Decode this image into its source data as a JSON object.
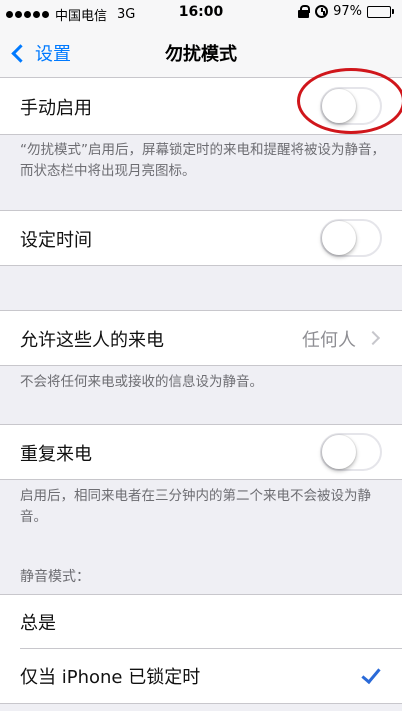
{
  "status_bar": {
    "carrier": "中国电信",
    "network": "3G",
    "time": "16:00",
    "battery": "97%",
    "battery_level": 0.97
  },
  "nav": {
    "back_label": "设置",
    "title": "勿扰模式"
  },
  "manual": {
    "label": "手动启用",
    "switch_on": false,
    "footer": "“勿扰模式”启用后，屏幕锁定时的来电和提醒将被设为静音，而状态栏中将出现月亮图标。"
  },
  "scheduled": {
    "label": "设定时间",
    "switch_on": false
  },
  "allow_calls": {
    "label": "允许这些人的来电",
    "value": "任何人",
    "footer": "不会将任何来电或接收的信息设为静音。"
  },
  "repeated": {
    "label": "重复来电",
    "switch_on": false,
    "footer": "启用后，相同来电者在三分钟内的第二个来电不会被设为静音。"
  },
  "silence": {
    "header": "静音模式：",
    "options": [
      {
        "label": "总是",
        "checked": false
      },
      {
        "label": "仅当 iPhone 已锁定时",
        "checked": true
      }
    ]
  },
  "colors": {
    "accent": "#007aff",
    "annotation": "#d0161b"
  }
}
